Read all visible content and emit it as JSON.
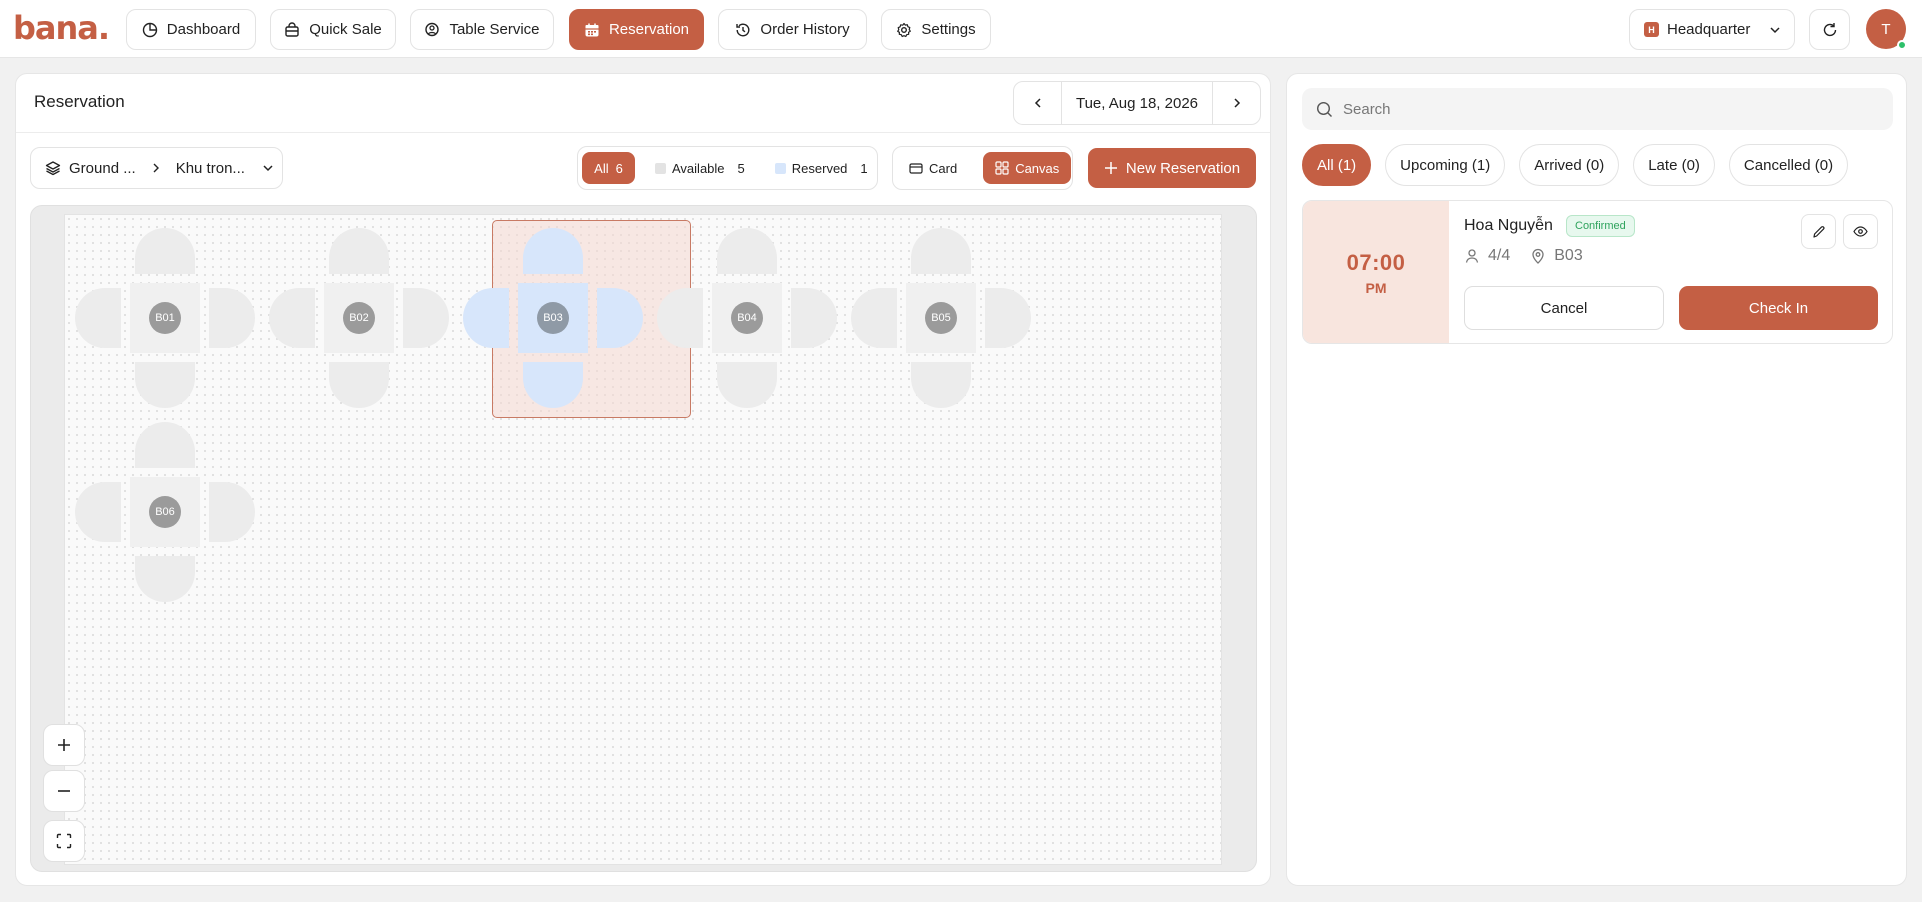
{
  "brand": {
    "logo_text": "bana."
  },
  "nav": {
    "items": [
      {
        "label": "Dashboard",
        "icon": "dashboard-icon"
      },
      {
        "label": "Quick Sale",
        "icon": "basket-icon"
      },
      {
        "label": "Table Service",
        "icon": "table-service-icon"
      },
      {
        "label": "Reservation",
        "icon": "calendar-icon",
        "active": true
      },
      {
        "label": "Order History",
        "icon": "history-icon"
      },
      {
        "label": "Settings",
        "icon": "gear-icon"
      }
    ]
  },
  "branch": {
    "badge": "H",
    "name": "Headquarter"
  },
  "user": {
    "initial": "T",
    "status": "online"
  },
  "reservation_panel": {
    "title": "Reservation",
    "date": "Tue, Aug 18, 2026",
    "floor": "Ground ...",
    "zone": "Khu tron...",
    "filters": {
      "all_label": "All",
      "all_count": "6",
      "available_label": "Available",
      "available_count": "5",
      "reserved_label": "Reserved",
      "reserved_count": "1"
    },
    "views": {
      "card_label": "Card",
      "canvas_label": "Canvas",
      "active": "canvas"
    },
    "new_reservation_label": "New Reservation",
    "tables": [
      {
        "name": "B01",
        "status": "available"
      },
      {
        "name": "B02",
        "status": "available"
      },
      {
        "name": "B03",
        "status": "reserved"
      },
      {
        "name": "B04",
        "status": "available"
      },
      {
        "name": "B05",
        "status": "available"
      },
      {
        "name": "B06",
        "status": "available"
      }
    ]
  },
  "list_panel": {
    "search_placeholder": "Search",
    "tabs": [
      "All (1)",
      "Upcoming (1)",
      "Arrived (0)",
      "Late (0)",
      "Cancelled (0)"
    ],
    "reservations": [
      {
        "time": "07:00",
        "period": "PM",
        "guest": "Hoa Nguyễn",
        "status": "Confirmed",
        "party": "4/4",
        "table": "B03",
        "cancel_label": "Cancel",
        "checkin_label": "Check In"
      }
    ]
  },
  "colors": {
    "accent": "#c45f44",
    "reserved": "#d7e6fb",
    "confirmed": "#2fa35d"
  }
}
